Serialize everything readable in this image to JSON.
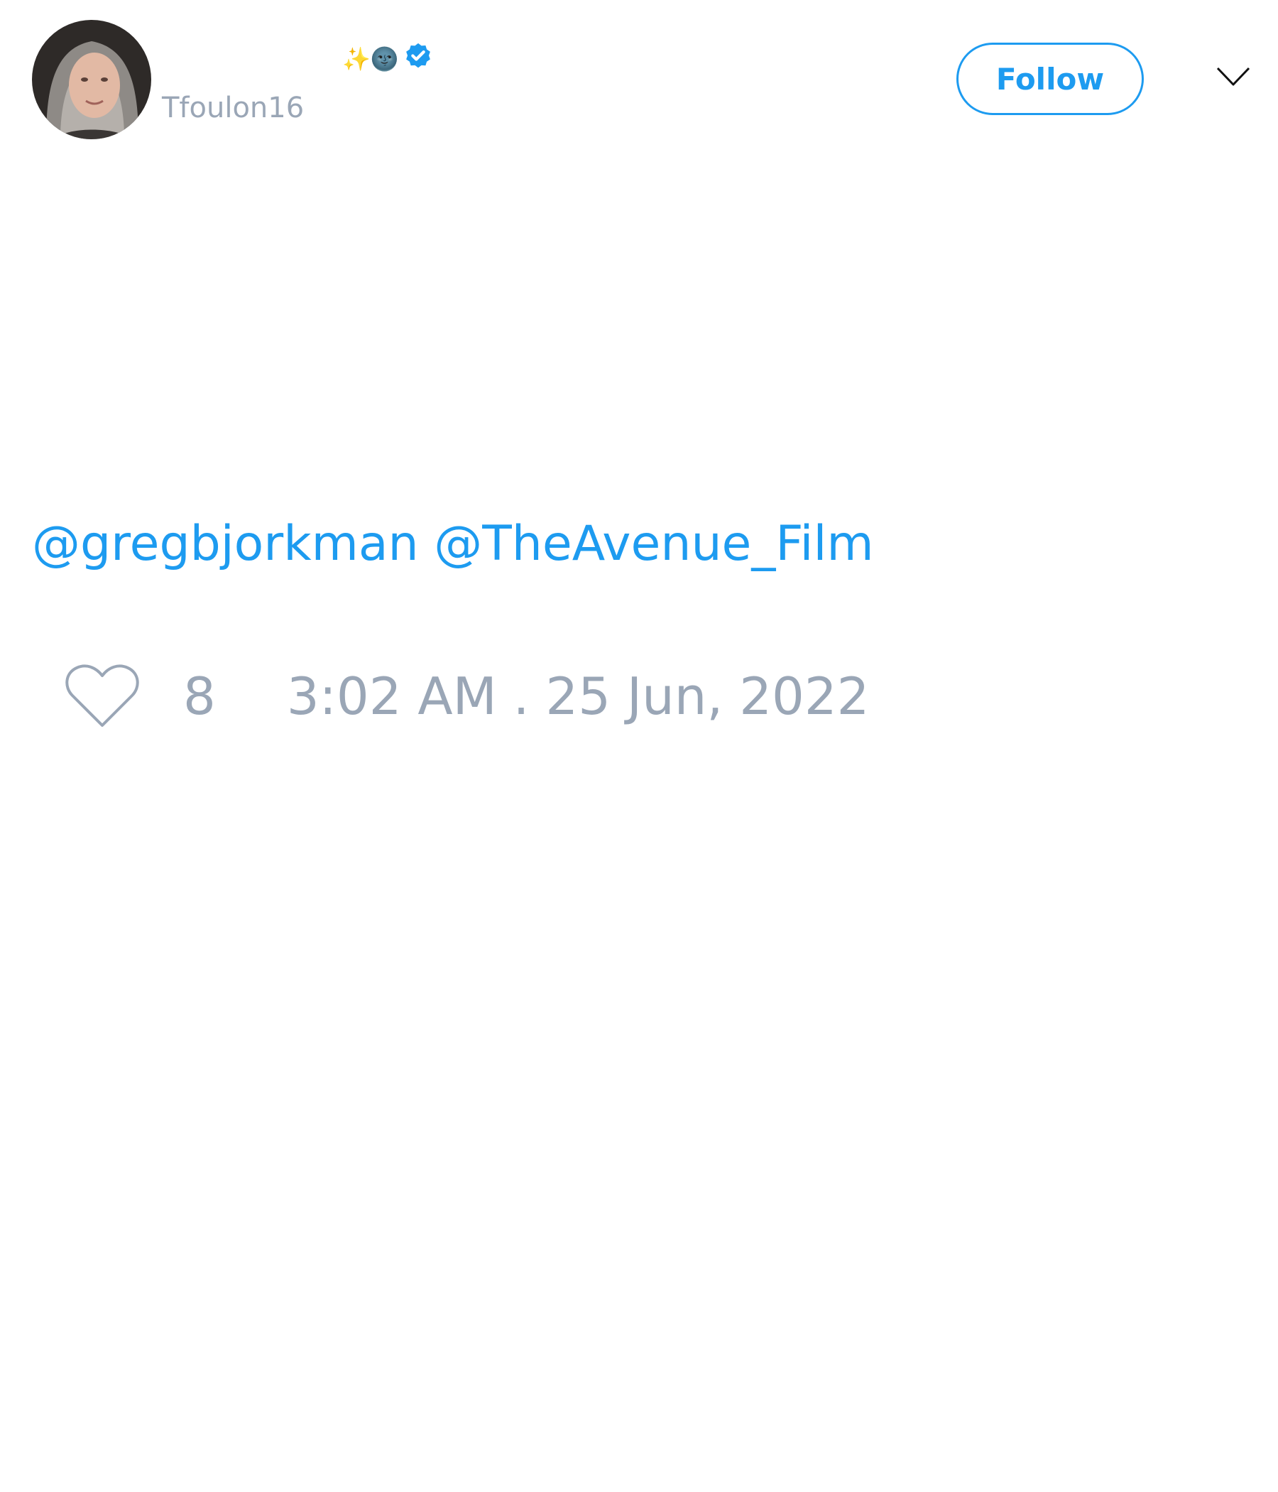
{
  "author": {
    "handle": "Tfoulon16",
    "name_emojis": "✨🌚"
  },
  "header": {
    "follow_label": "Follow"
  },
  "tweet": {
    "mentions": [
      "@gregbjorkman",
      "@TheAvenue_Film"
    ]
  },
  "footer": {
    "like_count": "8",
    "timestamp": "3:02 AM . 25 Jun, 2022"
  },
  "icons": {
    "verified": "verified-badge-icon",
    "like": "heart-icon",
    "menu": "chevron-down-icon"
  },
  "colors": {
    "accent": "#1d9bf0",
    "muted": "#9aa6b6"
  }
}
